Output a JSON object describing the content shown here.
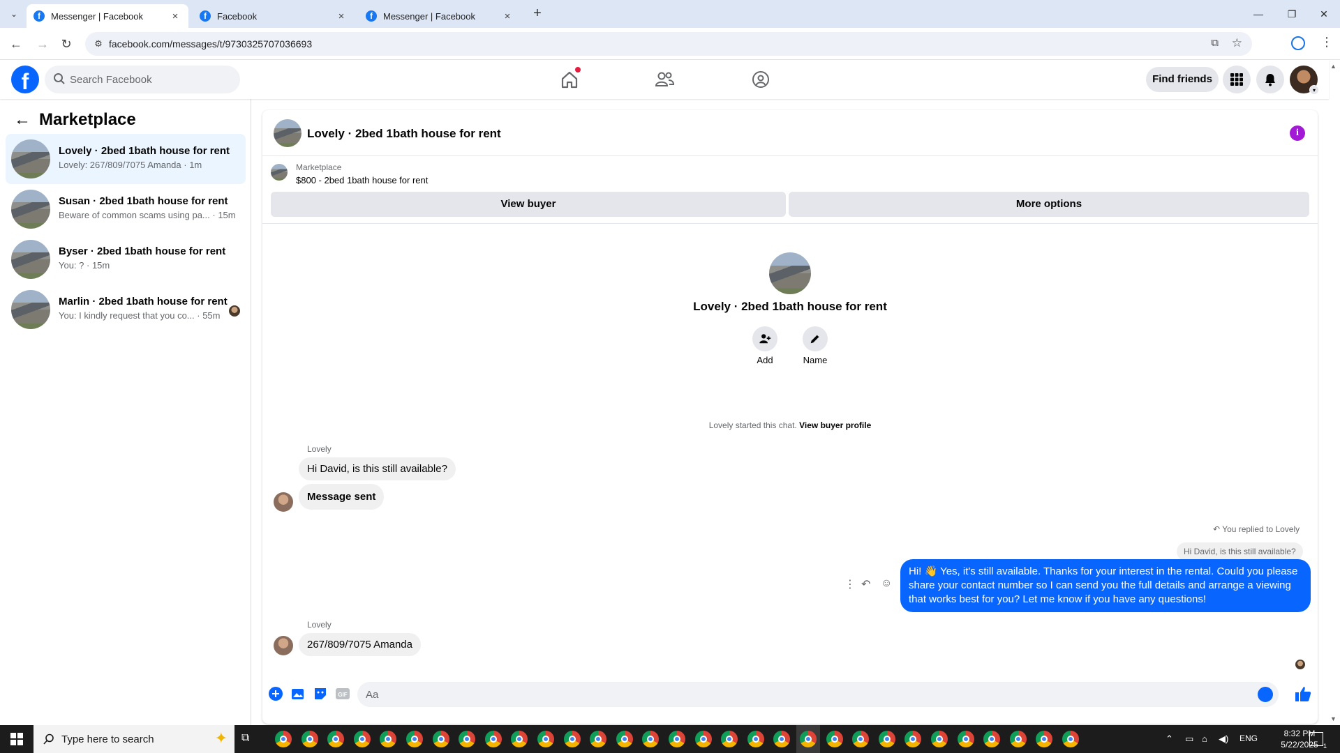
{
  "browser": {
    "tabs": [
      {
        "title": "Messenger | Facebook",
        "active": true
      },
      {
        "title": "Facebook",
        "active": false
      },
      {
        "title": "Messenger | Facebook",
        "active": false
      }
    ],
    "url": "facebook.com/messages/t/9730325707036693"
  },
  "fb_nav": {
    "search_placeholder": "Search Facebook",
    "find_friends": "Find friends",
    "icons": [
      "home-icon",
      "friends-icon",
      "groups-icon",
      "menu-grid-icon",
      "bell-icon"
    ]
  },
  "sidebar": {
    "title": "Marketplace",
    "conversations": [
      {
        "name": "Lovely · 2bed 1bath house for rent",
        "snippet": "Lovely: 267/809/7075 Amanda · 1m",
        "active": true
      },
      {
        "name": "Susan · 2bed 1bath house for rent",
        "snippet": "Beware of common scams using pa... · 15m",
        "active": false
      },
      {
        "name": "Byser · 2bed 1bath house for rent",
        "snippet": "You: ? · 15m",
        "active": false
      },
      {
        "name": "Marlin · 2bed 1bath house for rent",
        "snippet": "You: I kindly request that you co... · 55m",
        "active": false
      }
    ]
  },
  "chat": {
    "header_title": "Lovely · 2bed 1bath house for rent",
    "marketplace_label": "Marketplace",
    "listing": "$800 - 2bed 1bath house for rent",
    "view_buyer": "View buyer",
    "more_options": "More options",
    "profile_title": "Lovely · 2bed 1bath house for rent",
    "add_label": "Add",
    "name_label": "Name",
    "started_text": "Lovely started this chat.",
    "view_buyer_profile": "View buyer profile",
    "msg1_sender": "Lovely",
    "msg1_text": "Hi David, is this still available?",
    "msg2_text": "Message sent",
    "replied_to": "You replied to Lovely",
    "quoted_text": "Hi David, is this still available?",
    "reply_text": "Hi! 👋 Yes, it's still available. Thanks for your interest in the rental. Could you please share your contact number so I can send you the full details and arrange a viewing that works best for you? Let me know if you have any questions!",
    "msg3_sender": "Lovely",
    "msg3_text": "267/809/7075 Amanda",
    "composer_placeholder": "Aa"
  },
  "taskbar": {
    "search_text": "Type here to search",
    "lang": "ENG",
    "time": "8:32 PM",
    "date": "5/22/2025",
    "notif_count": "1"
  },
  "colors": {
    "fb_blue": "#0866ff",
    "active_conv_bg": "#ebf5ff",
    "info_purple": "#a31ad6"
  }
}
